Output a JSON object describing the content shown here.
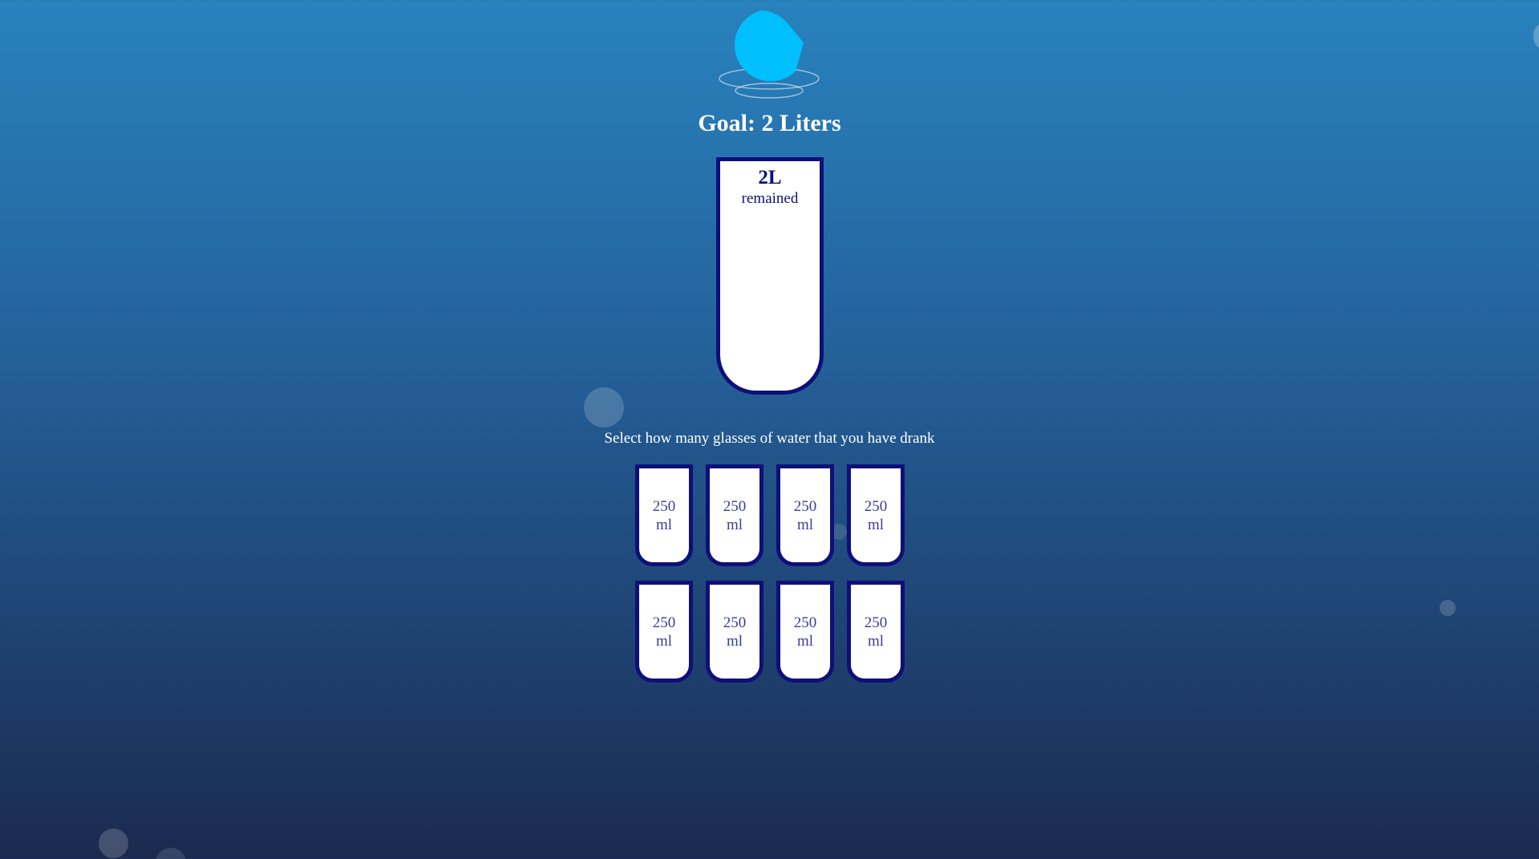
{
  "header": {
    "goal_title": "Goal: 2 Liters",
    "logo_icon": "water-drop-icon"
  },
  "big_cup": {
    "remained_amount": "2L",
    "remained_label": "remained",
    "fill_fraction": 0
  },
  "instruction": "Select how many glasses of water that you have drank",
  "cups": [
    {
      "amount": "250",
      "unit": "ml"
    },
    {
      "amount": "250",
      "unit": "ml"
    },
    {
      "amount": "250",
      "unit": "ml"
    },
    {
      "amount": "250",
      "unit": "ml"
    },
    {
      "amount": "250",
      "unit": "ml"
    },
    {
      "amount": "250",
      "unit": "ml"
    },
    {
      "amount": "250",
      "unit": "ml"
    },
    {
      "amount": "250",
      "unit": "ml"
    }
  ],
  "colors": {
    "background_top": "#2882bd",
    "background_bottom": "#1b2a4f",
    "cup_border": "#0f0f7a",
    "cup_text": "#3b3b9e",
    "drop": "#00bfff"
  }
}
